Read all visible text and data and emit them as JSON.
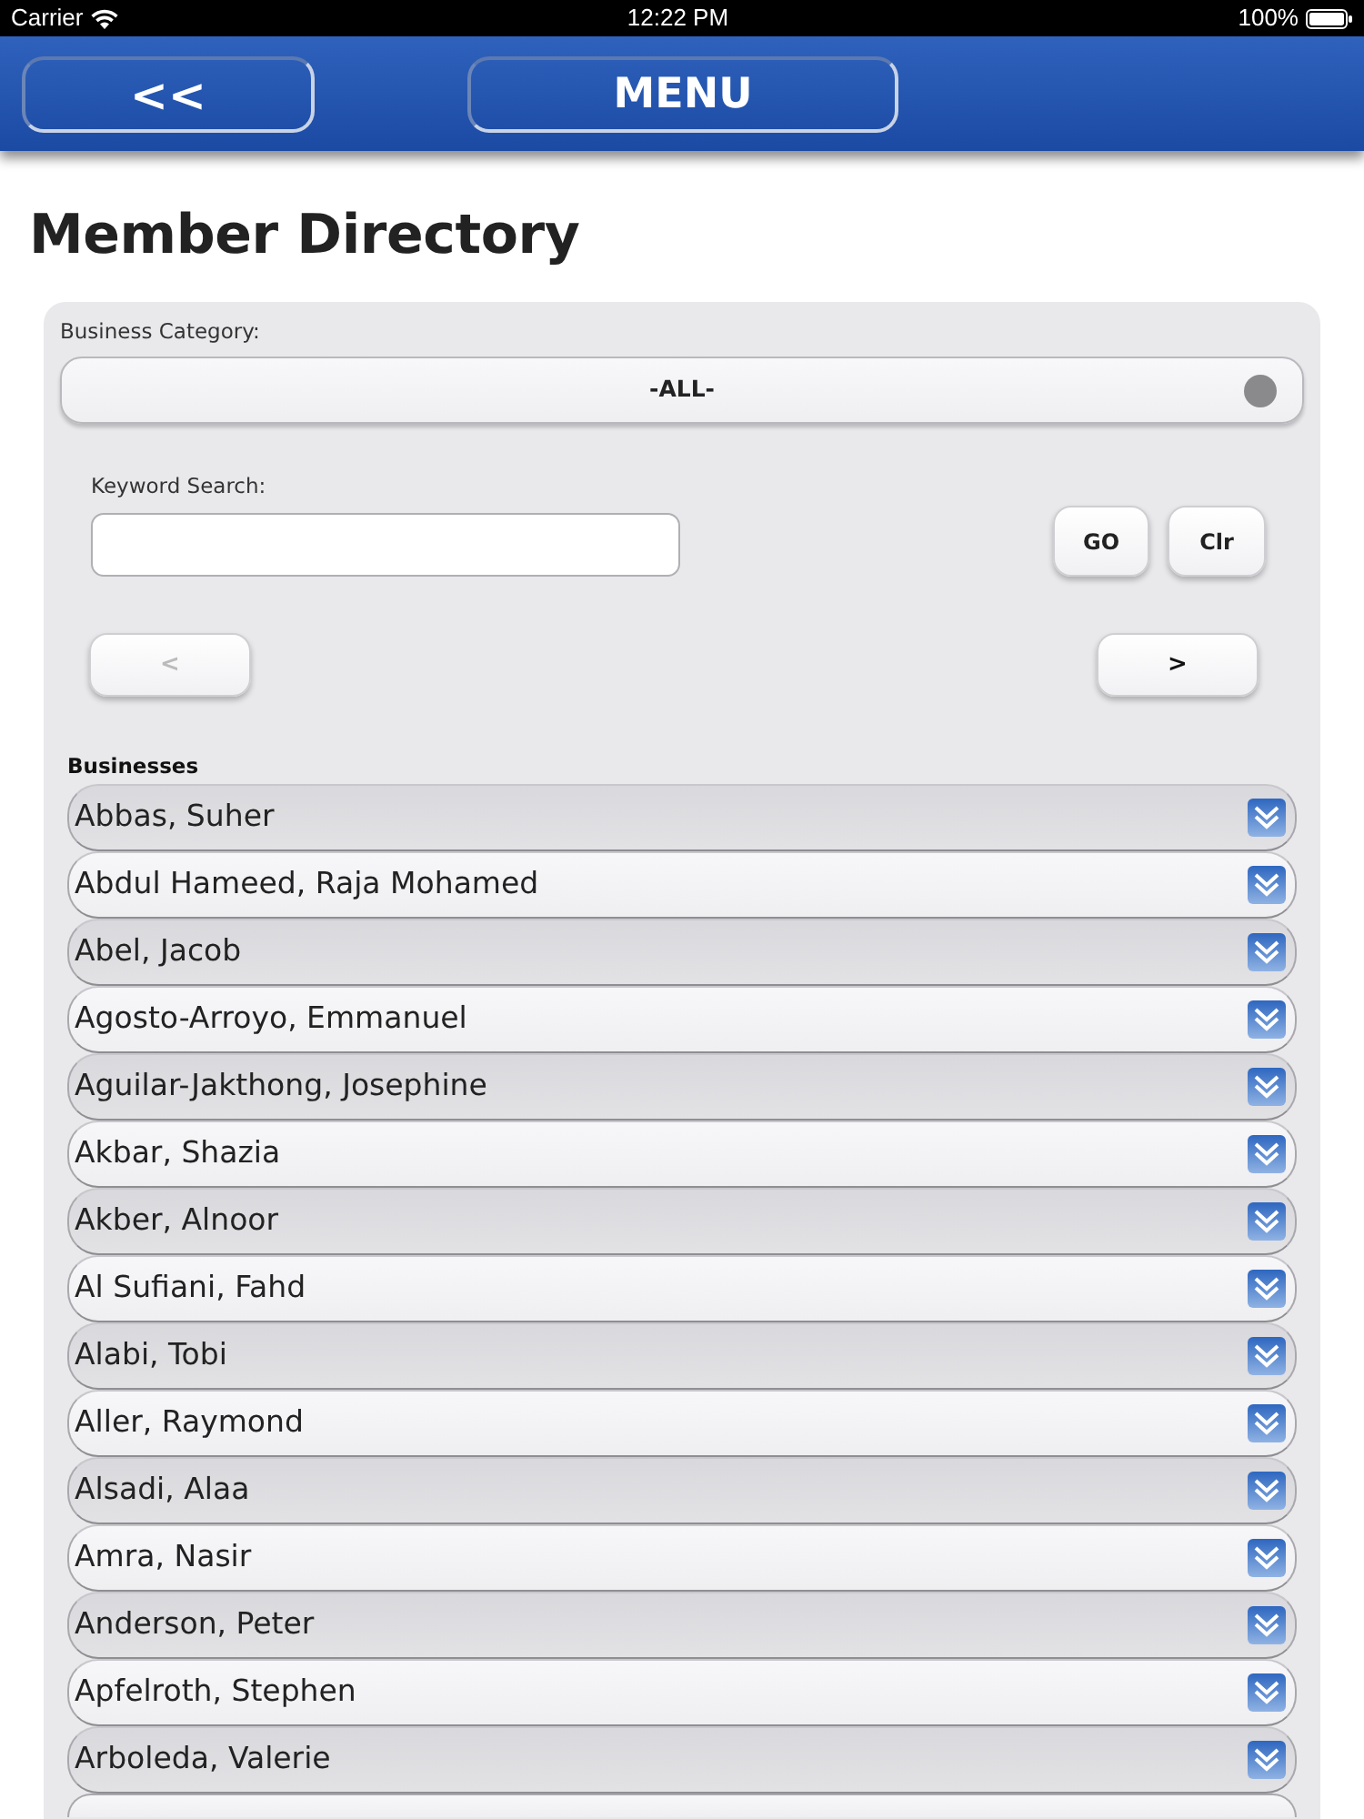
{
  "status_bar": {
    "carrier": "Carrier",
    "time": "12:22 PM",
    "battery": "100%"
  },
  "header": {
    "back_button": "<<",
    "menu_button": "MENU"
  },
  "title": "Member Directory",
  "filters": {
    "category_label": "Business Category:",
    "category_value": "-ALL-",
    "keyword_label": "Keyword Search:",
    "buttons": [
      {
        "label": "GO"
      },
      {
        "label": "Clr"
      }
    ]
  },
  "pager": [
    {
      "label": "<",
      "disabled": true
    },
    {
      "label": ">",
      "disabled": false
    }
  ],
  "list": {
    "heading": "Businesses",
    "rows": [
      {
        "name": "Abbas, Suher"
      },
      {
        "name": "Abdul Hameed, Raja Mohamed"
      },
      {
        "name": "Abel, Jacob"
      },
      {
        "name": "Agosto-Arroyo, Emmanuel"
      },
      {
        "name": "Aguilar-Jakthong, Josephine"
      },
      {
        "name": "Akbar, Shazia"
      },
      {
        "name": "Akber, Alnoor"
      },
      {
        "name": "Al Sufiani, Fahd"
      },
      {
        "name": "Alabi, Tobi"
      },
      {
        "name": "Aller, Raymond"
      },
      {
        "name": "Alsadi, Alaa"
      },
      {
        "name": "Amra, Nasir"
      },
      {
        "name": "Anderson, Peter"
      },
      {
        "name": "Apfelroth, Stephen"
      },
      {
        "name": "Arboleda, Valerie"
      }
    ],
    "more_below": true
  }
}
